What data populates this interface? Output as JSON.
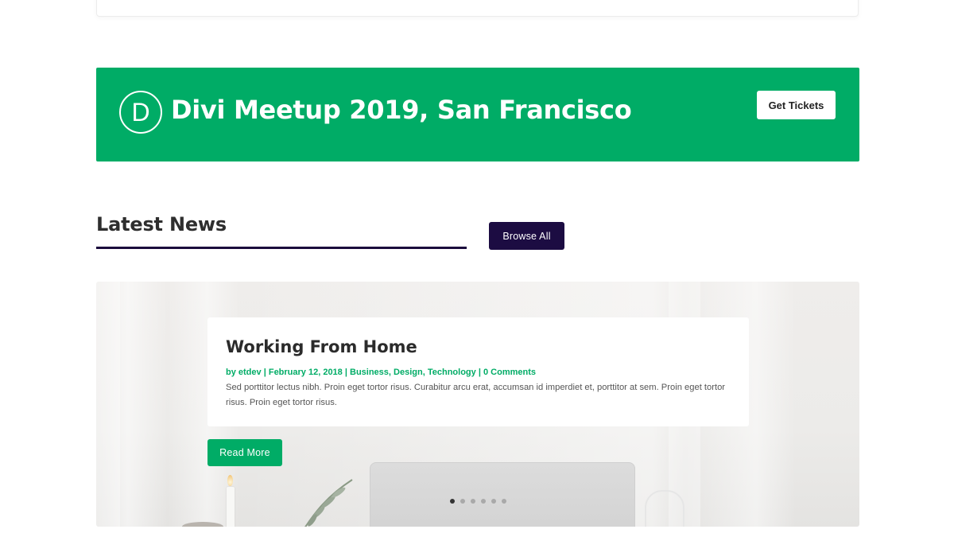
{
  "banner": {
    "logo_letter": "D",
    "title": "Divi Meetup 2019, San Francisco",
    "button_label": "Get Tickets",
    "background": "#00ac66"
  },
  "news": {
    "heading": "Latest News",
    "browse_label": "Browse All",
    "browse_color": "#1c0c42"
  },
  "post": {
    "title": "Working From Home",
    "author": "by etdev",
    "date": "February 12, 2018",
    "categories": [
      "Business",
      "Design",
      "Technology"
    ],
    "comments": "0 Comments",
    "excerpt": "Sed porttitor lectus nibh. Proin eget tortor risus. Curabitur arcu erat, accumsan id imperdiet et, porttitor at sem. Proin eget tortor risus. Proin eget tortor risus.",
    "read_more": "Read More",
    "accent": "#00ac66"
  },
  "slider": {
    "slide_count": 6,
    "active_index": 0
  }
}
